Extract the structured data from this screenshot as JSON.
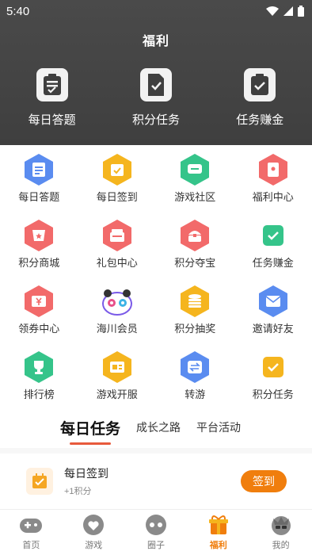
{
  "status": {
    "time": "5:40"
  },
  "header": {
    "title": "福利",
    "actions": [
      {
        "label": "每日答题",
        "icon": "clipboard-list-icon"
      },
      {
        "label": "积分任务",
        "icon": "document-check-icon"
      },
      {
        "label": "任务赚金",
        "icon": "clipboard-check-icon"
      }
    ]
  },
  "grid": {
    "items": [
      {
        "label": "每日答题",
        "icon": "notepad-icon",
        "color": "#5a8cf0"
      },
      {
        "label": "每日签到",
        "icon": "calendar-check-icon",
        "color": "#f5b51e"
      },
      {
        "label": "游戏社区",
        "icon": "chat-icon",
        "color": "#35c48a"
      },
      {
        "label": "福利中心",
        "icon": "red-envelope-icon",
        "color": "#f26a6a"
      },
      {
        "label": "积分商城",
        "icon": "shop-icon",
        "color": "#f26a6a"
      },
      {
        "label": "礼包中心",
        "icon": "gift-box-icon",
        "color": "#f26a6a"
      },
      {
        "label": "积分夺宝",
        "icon": "treasure-icon",
        "color": "#f26a6a"
      },
      {
        "label": "任务赚金",
        "icon": "clipboard-check-icon",
        "color": "#35c48a"
      },
      {
        "label": "领券中心",
        "icon": "coupon-icon",
        "color": "#f26a6a"
      },
      {
        "label": "海川会员",
        "icon": "panda-mascot-icon",
        "color": "#7a5ae8"
      },
      {
        "label": "积分抽奖",
        "icon": "coin-stack-icon",
        "color": "#f5b51e"
      },
      {
        "label": "邀请好友",
        "icon": "invite-icon",
        "color": "#5a8cf0"
      },
      {
        "label": "排行榜",
        "icon": "trophy-icon",
        "color": "#35c48a"
      },
      {
        "label": "游戏开服",
        "icon": "server-icon",
        "color": "#f5b51e"
      },
      {
        "label": "转游",
        "icon": "transfer-game-icon",
        "color": "#5a8cf0"
      },
      {
        "label": "积分任务",
        "icon": "task-icon",
        "color": "#f5b51e"
      }
    ]
  },
  "tabs": [
    {
      "label": "每日任务",
      "active": true
    },
    {
      "label": "成长之路",
      "active": false
    },
    {
      "label": "平台活动",
      "active": false
    }
  ],
  "task": {
    "title": "每日签到",
    "reward": "+1积分",
    "button": "签到",
    "icon": "calendar-check-icon"
  },
  "nav": [
    {
      "label": "首页",
      "icon": "home-gamepad-icon",
      "active": false
    },
    {
      "label": "游戏",
      "icon": "game-heart-icon",
      "active": false
    },
    {
      "label": "圈子",
      "icon": "circle-chat-icon",
      "active": false
    },
    {
      "label": "福利",
      "icon": "gift-icon",
      "active": true
    },
    {
      "label": "我的",
      "icon": "profile-icon",
      "active": false
    }
  ],
  "colors": {
    "accent": "#f07e0d",
    "header_bg": "#434343",
    "tab_underline": "#e85a3c"
  }
}
